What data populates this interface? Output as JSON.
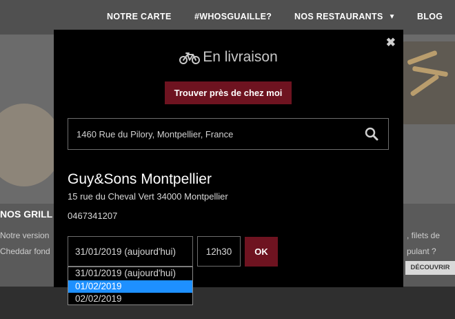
{
  "nav": {
    "items": [
      {
        "label": "NOTRE CARTE"
      },
      {
        "label": "#WHOSGUAILLE?"
      },
      {
        "label": "NOS RESTAURANTS",
        "has_chevron": true
      },
      {
        "label": "BLOG"
      }
    ]
  },
  "background_card": {
    "title": "NOS GRILL",
    "line1": "Notre version",
    "line2": "Cheddar fond",
    "right1": ", filets de",
    "right2": "pulant ?",
    "discover_label": "DÉCOUVRIR"
  },
  "modal": {
    "icon": "bicycle-icon",
    "title": "En livraison",
    "find_button_label": "Trouver près de chez moi",
    "search_value": "1460 Rue du Pilory, Montpellier, France",
    "search_icon": "search-icon",
    "close_icon": "close-icon",
    "restaurant": {
      "name": "Guy&Sons Montpellier",
      "address": "15 rue du Cheval Vert 34000 Montpellier",
      "phone": "0467341207"
    },
    "date_selected": "31/01/2019 (aujourd'hui)",
    "time_selected": "12h30",
    "ok_label": "OK",
    "date_options": [
      "31/01/2019 (aujourd'hui)",
      "01/02/2019",
      "02/02/2019"
    ],
    "highlighted_option_index": 1
  },
  "colors": {
    "accent": "#6e1320",
    "modal_bg": "#000000",
    "highlight": "#1e90ff"
  }
}
